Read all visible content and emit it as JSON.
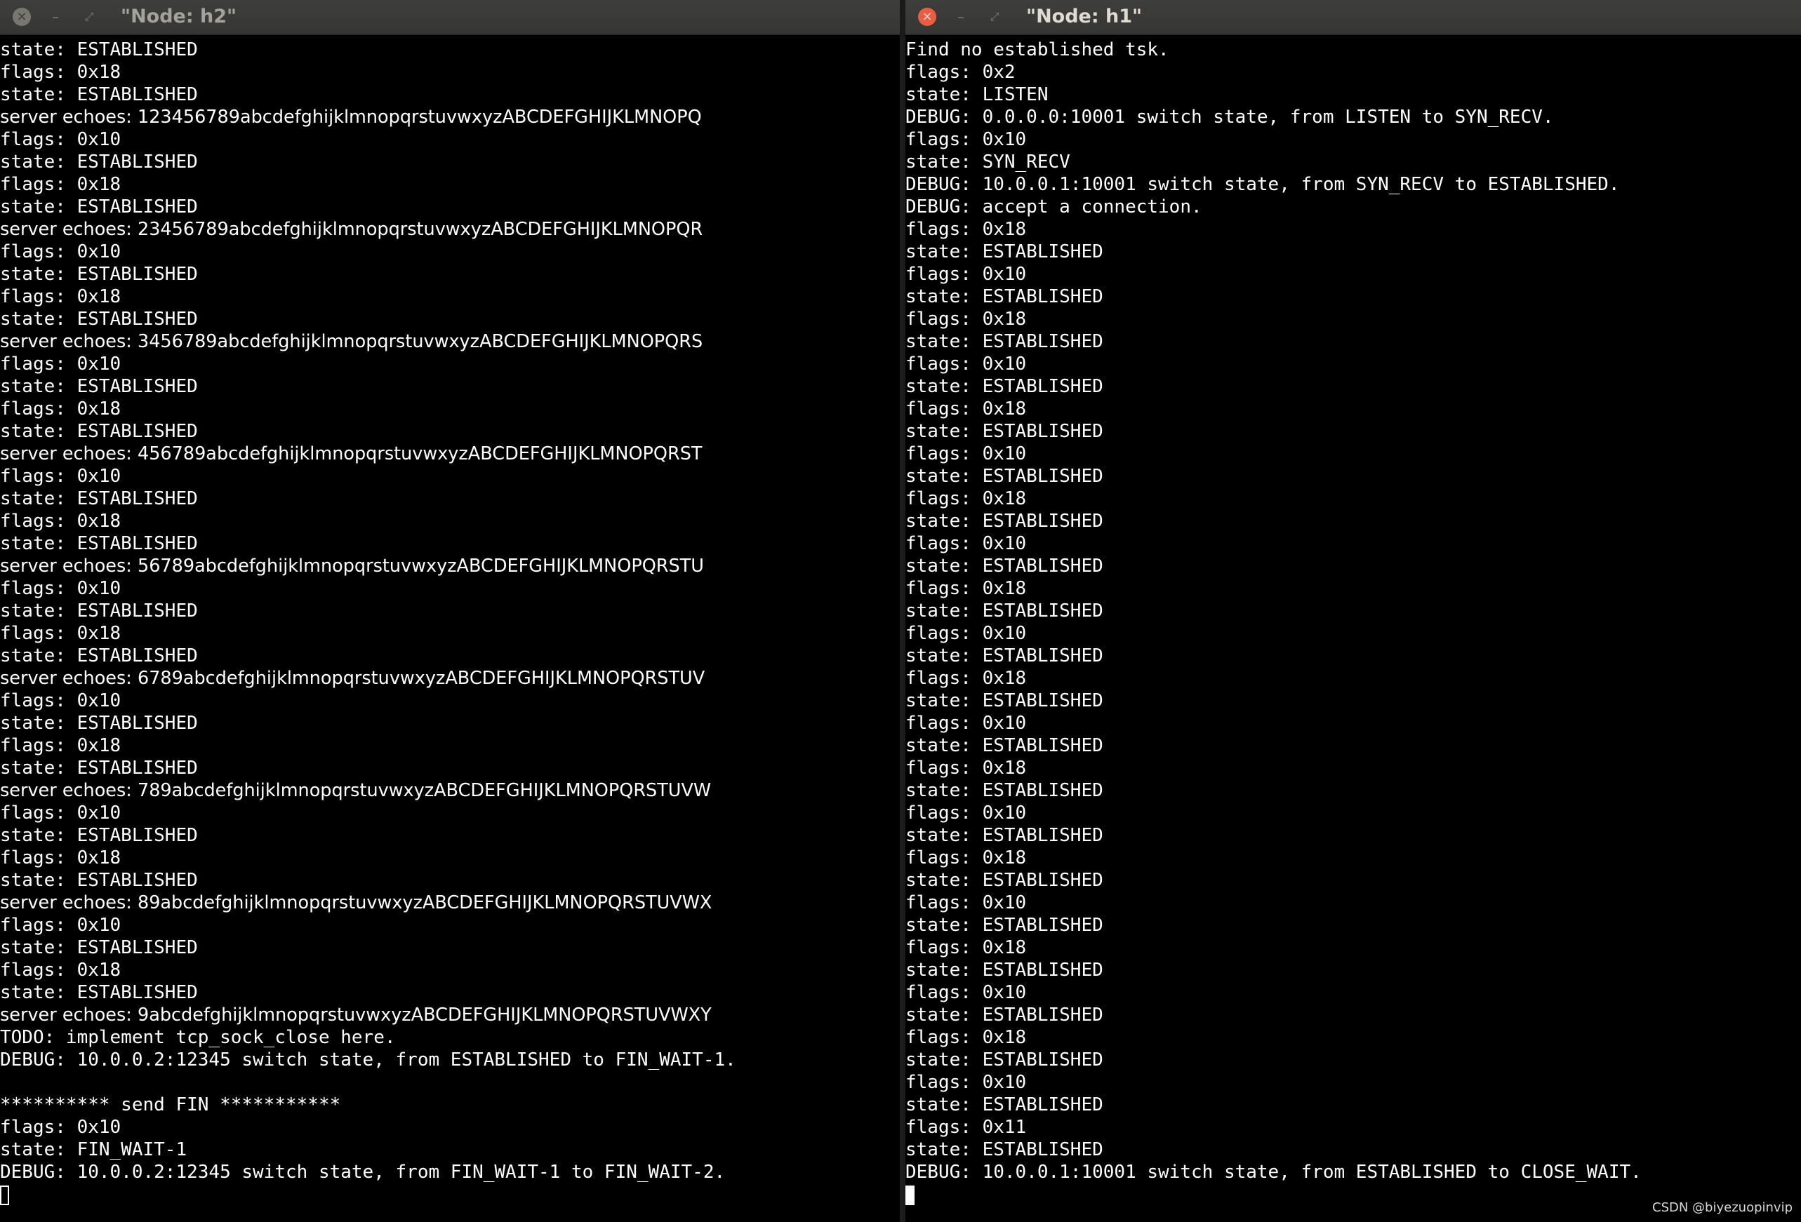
{
  "left": {
    "title": "\"Node: h2\"",
    "close_glyph": "×",
    "min_glyph": "–",
    "max_glyph": "⤢",
    "lines": [
      {
        "text": "state: ESTABLISHED"
      },
      {
        "text": "flags: 0x18"
      },
      {
        "text": "state: ESTABLISHED"
      },
      {
        "text": "server echoes: 123456789abcdefghijklmnopqrstuvwxyzABCDEFGHIJKLMNOPQ",
        "prop": true
      },
      {
        "text": "flags: 0x10"
      },
      {
        "text": "state: ESTABLISHED"
      },
      {
        "text": "flags: 0x18"
      },
      {
        "text": "state: ESTABLISHED"
      },
      {
        "text": "server echoes: 23456789abcdefghijklmnopqrstuvwxyzABCDEFGHIJKLMNOPQR",
        "prop": true
      },
      {
        "text": "flags: 0x10"
      },
      {
        "text": "state: ESTABLISHED"
      },
      {
        "text": "flags: 0x18"
      },
      {
        "text": "state: ESTABLISHED"
      },
      {
        "text": "server echoes: 3456789abcdefghijklmnopqrstuvwxyzABCDEFGHIJKLMNOPQRS",
        "prop": true
      },
      {
        "text": "flags: 0x10"
      },
      {
        "text": "state: ESTABLISHED"
      },
      {
        "text": "flags: 0x18"
      },
      {
        "text": "state: ESTABLISHED"
      },
      {
        "text": "server echoes: 456789abcdefghijklmnopqrstuvwxyzABCDEFGHIJKLMNOPQRST",
        "prop": true
      },
      {
        "text": "flags: 0x10"
      },
      {
        "text": "state: ESTABLISHED"
      },
      {
        "text": "flags: 0x18"
      },
      {
        "text": "state: ESTABLISHED"
      },
      {
        "text": "server echoes: 56789abcdefghijklmnopqrstuvwxyzABCDEFGHIJKLMNOPQRSTU",
        "prop": true
      },
      {
        "text": "flags: 0x10"
      },
      {
        "text": "state: ESTABLISHED"
      },
      {
        "text": "flags: 0x18"
      },
      {
        "text": "state: ESTABLISHED"
      },
      {
        "text": "server echoes: 6789abcdefghijklmnopqrstuvwxyzABCDEFGHIJKLMNOPQRSTUV",
        "prop": true
      },
      {
        "text": "flags: 0x10"
      },
      {
        "text": "state: ESTABLISHED"
      },
      {
        "text": "flags: 0x18"
      },
      {
        "text": "state: ESTABLISHED"
      },
      {
        "text": "server echoes: 789abcdefghijklmnopqrstuvwxyzABCDEFGHIJKLMNOPQRSTUVW",
        "prop": true
      },
      {
        "text": "flags: 0x10"
      },
      {
        "text": "state: ESTABLISHED"
      },
      {
        "text": "flags: 0x18"
      },
      {
        "text": "state: ESTABLISHED"
      },
      {
        "text": "server echoes: 89abcdefghijklmnopqrstuvwxyzABCDEFGHIJKLMNOPQRSTUVWX",
        "prop": true
      },
      {
        "text": "flags: 0x10"
      },
      {
        "text": "state: ESTABLISHED"
      },
      {
        "text": "flags: 0x18"
      },
      {
        "text": "state: ESTABLISHED"
      },
      {
        "text": "server echoes: 9abcdefghijklmnopqrstuvwxyzABCDEFGHIJKLMNOPQRSTUVWXY",
        "prop": true
      },
      {
        "text": "TODO: implement tcp_sock_close here."
      },
      {
        "text": "DEBUG: 10.0.0.2:12345 switch state, from ESTABLISHED to FIN_WAIT-1."
      },
      {
        "text": ""
      },
      {
        "text": "********** send FIN ***********"
      },
      {
        "text": "flags: 0x10"
      },
      {
        "text": "state: FIN_WAIT-1"
      },
      {
        "text": "DEBUG: 10.0.0.2:12345 switch state, from FIN_WAIT-1 to FIN_WAIT-2."
      }
    ]
  },
  "right": {
    "title": "\"Node: h1\"",
    "close_glyph": "×",
    "min_glyph": "–",
    "max_glyph": "⤢",
    "lines": [
      {
        "text": "Find no established tsk."
      },
      {
        "text": "flags: 0x2"
      },
      {
        "text": "state: LISTEN"
      },
      {
        "text": "DEBUG: 0.0.0.0:10001 switch state, from LISTEN to SYN_RECV."
      },
      {
        "text": "flags: 0x10"
      },
      {
        "text": "state: SYN_RECV"
      },
      {
        "text": "DEBUG: 10.0.0.1:10001 switch state, from SYN_RECV to ESTABLISHED."
      },
      {
        "text": "DEBUG: accept a connection."
      },
      {
        "text": "flags: 0x18"
      },
      {
        "text": "state: ESTABLISHED"
      },
      {
        "text": "flags: 0x10"
      },
      {
        "text": "state: ESTABLISHED"
      },
      {
        "text": "flags: 0x18"
      },
      {
        "text": "state: ESTABLISHED"
      },
      {
        "text": "flags: 0x10"
      },
      {
        "text": "state: ESTABLISHED"
      },
      {
        "text": "flags: 0x18"
      },
      {
        "text": "state: ESTABLISHED"
      },
      {
        "text": "flags: 0x10"
      },
      {
        "text": "state: ESTABLISHED"
      },
      {
        "text": "flags: 0x18"
      },
      {
        "text": "state: ESTABLISHED"
      },
      {
        "text": "flags: 0x10"
      },
      {
        "text": "state: ESTABLISHED"
      },
      {
        "text": "flags: 0x18"
      },
      {
        "text": "state: ESTABLISHED"
      },
      {
        "text": "flags: 0x10"
      },
      {
        "text": "state: ESTABLISHED"
      },
      {
        "text": "flags: 0x18"
      },
      {
        "text": "state: ESTABLISHED"
      },
      {
        "text": "flags: 0x10"
      },
      {
        "text": "state: ESTABLISHED"
      },
      {
        "text": "flags: 0x18"
      },
      {
        "text": "state: ESTABLISHED"
      },
      {
        "text": "flags: 0x10"
      },
      {
        "text": "state: ESTABLISHED"
      },
      {
        "text": "flags: 0x18"
      },
      {
        "text": "state: ESTABLISHED"
      },
      {
        "text": "flags: 0x10"
      },
      {
        "text": "state: ESTABLISHED"
      },
      {
        "text": "flags: 0x18"
      },
      {
        "text": "state: ESTABLISHED"
      },
      {
        "text": "flags: 0x10"
      },
      {
        "text": "state: ESTABLISHED"
      },
      {
        "text": "flags: 0x18"
      },
      {
        "text": "state: ESTABLISHED"
      },
      {
        "text": "flags: 0x10"
      },
      {
        "text": "state: ESTABLISHED"
      },
      {
        "text": "flags: 0x11"
      },
      {
        "text": "state: ESTABLISHED"
      },
      {
        "text": "DEBUG: 10.0.0.1:10001 switch state, from ESTABLISHED to CLOSE_WAIT."
      }
    ]
  },
  "watermark": "CSDN @biyezuopinvip"
}
